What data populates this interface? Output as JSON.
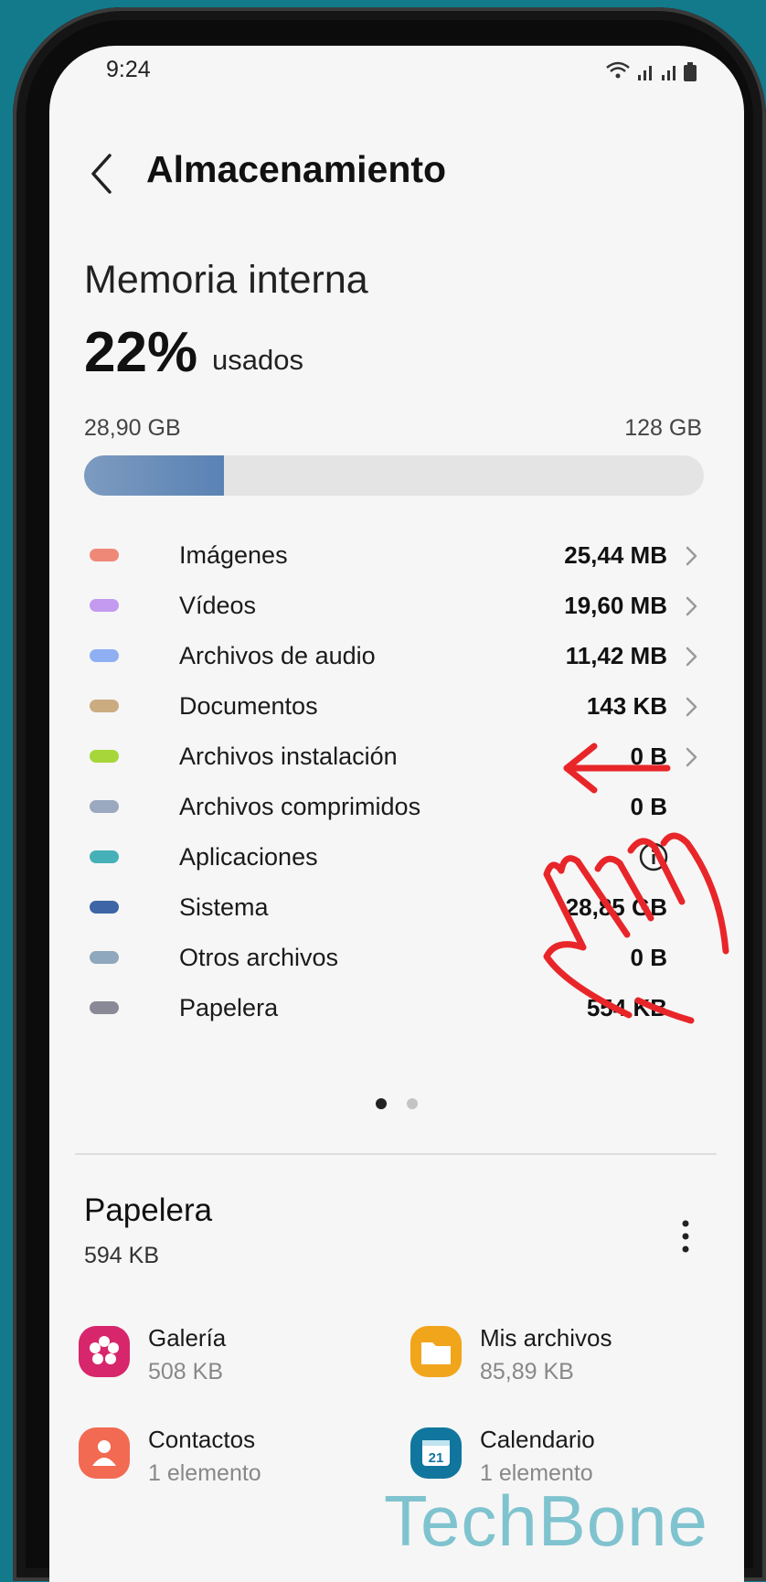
{
  "status_bar": {
    "time": "9:24"
  },
  "header": {
    "title": "Almacenamiento"
  },
  "internal_memory": {
    "title": "Memoria interna",
    "percent_used": "22%",
    "percent_suffix": "usados",
    "used": "28,90 GB",
    "total": "128 GB",
    "usage_fraction": 0.226
  },
  "categories": [
    {
      "label": "Imágenes",
      "value": "25,44 MB",
      "color": "#f08878"
    },
    {
      "label": "Vídeos",
      "value": "19,60 MB",
      "color": "#c39af0"
    },
    {
      "label": "Archivos de audio",
      "value": "11,42 MB",
      "color": "#8eb0f2"
    },
    {
      "label": "Documentos",
      "value": "143 KB",
      "color": "#cbab80"
    },
    {
      "label": "Archivos instalación",
      "value": "0 B",
      "color": "#a6d63a"
    },
    {
      "label": "Archivos comprimidos",
      "value": "0 B",
      "color": "#9aa8c0"
    },
    {
      "label": "Aplicaciones",
      "value": "",
      "color": "#46b0b8"
    },
    {
      "label": "Sistema",
      "value": "28,85 GB",
      "color": "#3e66a6"
    },
    {
      "label": "Otros archivos",
      "value": "0 B",
      "color": "#8fa8bd"
    },
    {
      "label": "Papelera",
      "value": "554 KB",
      "color": "#8a8a96"
    }
  ],
  "pager": {
    "pages": 2,
    "current": 1
  },
  "trash": {
    "title": "Papelera",
    "size": "594 KB",
    "apps": [
      {
        "name": "Galería",
        "sub": "508 KB",
        "icon": "gallery-icon",
        "color": "#d7266c"
      },
      {
        "name": "Mis archivos",
        "sub": "85,89 KB",
        "icon": "folder-icon",
        "color": "#f1a51b"
      },
      {
        "name": "Contactos",
        "sub": "1 elemento",
        "icon": "contacts-icon",
        "color": "#f26a52"
      },
      {
        "name": "Calendario",
        "sub": "1 elemento",
        "icon": "calendar-icon",
        "color": "#11769e",
        "day": "21"
      }
    ]
  },
  "watermark": "TechBone"
}
